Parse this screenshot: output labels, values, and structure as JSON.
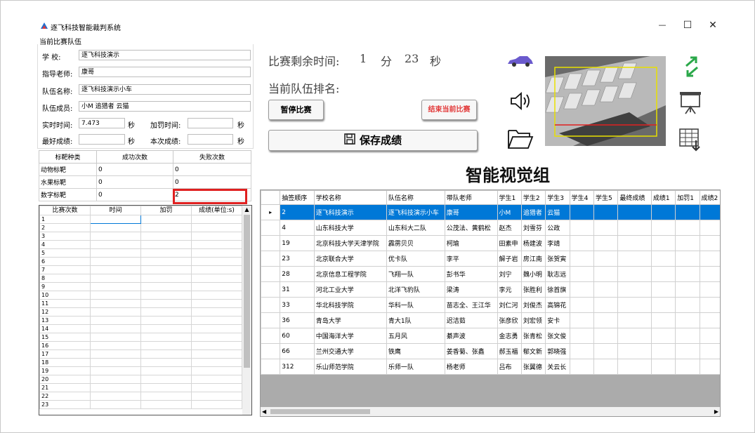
{
  "app": {
    "title": "逐飞科技智能裁判系统"
  },
  "window_controls": {
    "minimize": "—",
    "maximize": "☐",
    "close": "✕"
  },
  "team_panel": {
    "group_title": "当前比赛队伍",
    "school_label": "学    校:",
    "school_value": "逐飞科技演示",
    "teacher_label": "指导老师:",
    "teacher_value": "康哥",
    "team_label": "队伍名称:",
    "team_value": "逐飞科技演示小车",
    "members_label": "队伍成员:",
    "members_value": "小M 追猎者 云猫",
    "realtime_label": "实时时间:",
    "realtime_value": "7.473",
    "realtime_unit": "秒",
    "penalty_label": "加罚时间:",
    "penalty_value": "",
    "penalty_unit": "秒",
    "best_label": "最好成绩:",
    "best_value": "",
    "best_unit": "秒",
    "current_label": "本次成绩:",
    "current_value": "",
    "current_unit": "秒"
  },
  "target_table": {
    "headers": [
      "标靶种类",
      "成功次数",
      "失败次数"
    ],
    "rows": [
      [
        "动物标靶",
        "0",
        "0"
      ],
      [
        "水果标靶",
        "0",
        "0"
      ],
      [
        "数字标靶",
        "0",
        "2"
      ]
    ]
  },
  "score_table": {
    "headers": [
      "比赛次数",
      "时间",
      "加罚",
      "成绩(单位:s)"
    ],
    "rows": [
      "1",
      "2",
      "3",
      "4",
      "5",
      "6",
      "7",
      "8",
      "9",
      "10",
      "11",
      "12",
      "13",
      "14",
      "15",
      "16",
      "17",
      "18",
      "19",
      "20",
      "21",
      "22",
      "23"
    ]
  },
  "timer": {
    "label": "比赛剩余时间:",
    "minutes": "1",
    "min_unit": "分",
    "seconds": "23",
    "sec_unit": "秒"
  },
  "rank_label": "当前队伍排名:",
  "buttons": {
    "pause": "暂停比赛",
    "end": "结束当前比赛",
    "save": "保存成绩"
  },
  "group_title": "智能视觉组",
  "colors": {
    "end_button_text": "#e23a3a",
    "selection": "#0078d7",
    "highlight_box": "#e02020"
  },
  "icons": [
    "car-icon",
    "speaker-icon",
    "folder-icon",
    "swap-icon",
    "projector-icon",
    "export-table-icon"
  ],
  "rank_table": {
    "headers": [
      "抽签顺序",
      "学校名称",
      "队伍名称",
      "带队老师",
      "学生1",
      "学生2",
      "学生3",
      "学生4",
      "学生5",
      "最终成绩",
      "成绩1",
      "加罚1",
      "成绩2"
    ],
    "rows": [
      [
        "2",
        "逐飞科技演示",
        "逐飞科技演示小车",
        "康哥",
        "小M",
        "追猎者",
        "云猫"
      ],
      [
        "4",
        "山东科技大学",
        "山东科大二队",
        "公茂法、黄鹤松",
        "赵杰",
        "刘雪芬",
        "公政"
      ],
      [
        "19",
        "北京科技大学天津学院",
        "霹雳贝贝",
        "柯瑜",
        "田素申",
        "杨建波",
        "李靖"
      ],
      [
        "23",
        "北京联合大学",
        "优卡队",
        "李平",
        "解子岩",
        "房江南",
        "张贺寅"
      ],
      [
        "28",
        "北京信息工程学院",
        "飞翔一队",
        "彭书华",
        "刘宁",
        "魏小明",
        "耿志远"
      ],
      [
        "31",
        "河北工业大学",
        "北洋飞豹队",
        "梁涛",
        "李元",
        "张胜利",
        "徐首旗"
      ],
      [
        "33",
        "华北科技学院",
        "华科一队",
        "苗志全、王江华",
        "刘仁河",
        "刘俊杰",
        "高锦花"
      ],
      [
        "36",
        "青岛大学",
        "青大1队",
        "迟洁茹",
        "张彦欣",
        "刘宏领",
        "安卡"
      ],
      [
        "60",
        "中国海洋大学",
        "五月风",
        "綦声波",
        "金志勇",
        "张青松",
        "张文俊"
      ],
      [
        "66",
        "兰州交通大学",
        "铁鹰",
        "姜香菊、张鑫",
        "郝玉福",
        "郁文新",
        "郭晓强"
      ],
      [
        "312",
        "乐山师范学院",
        "乐师一队",
        "杨老师",
        "吕布",
        "张翼德",
        "关云长"
      ]
    ]
  }
}
